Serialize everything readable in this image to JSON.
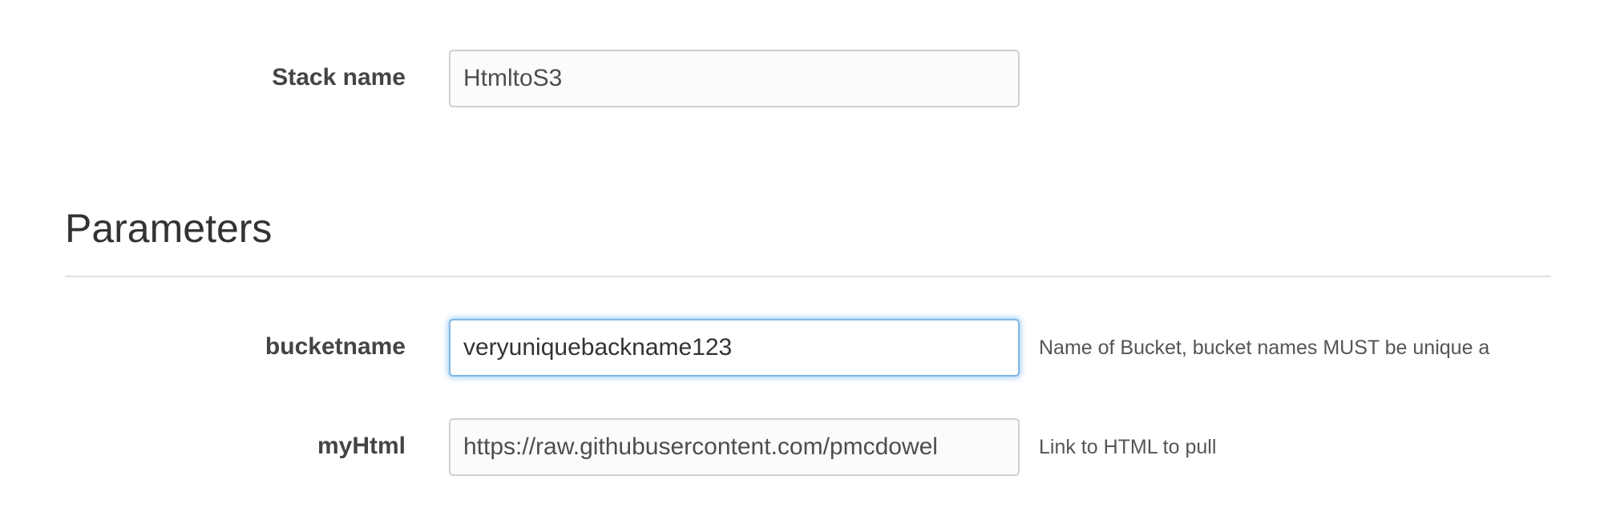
{
  "stack": {
    "label": "Stack name",
    "value": "HtmltoS3"
  },
  "parameters": {
    "title": "Parameters",
    "items": [
      {
        "label": "bucketname",
        "value": "veryuniquebackname123",
        "help": "Name of Bucket, bucket names MUST be unique a"
      },
      {
        "label": "myHtml",
        "value": "https://raw.githubusercontent.com/pmcdowel",
        "help": "Link to HTML to pull"
      }
    ]
  }
}
